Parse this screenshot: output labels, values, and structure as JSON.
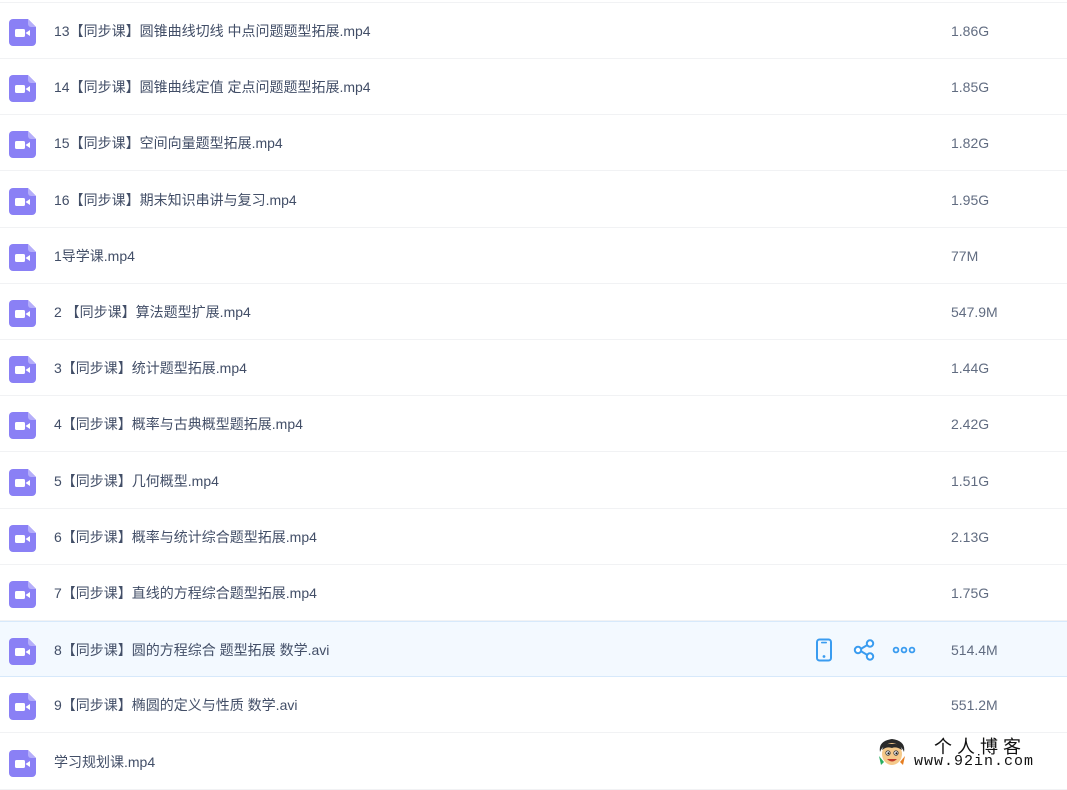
{
  "file_list": {
    "items": [
      {
        "name": "13【同步课】圆锥曲线切线 中点问题题型拓展.mp4",
        "size": "1.86G",
        "icon": "video-file-icon"
      },
      {
        "name": "14【同步课】圆锥曲线定值 定点问题题型拓展.mp4",
        "size": "1.85G",
        "icon": "video-file-icon"
      },
      {
        "name": "15【同步课】空间向量题型拓展.mp4",
        "size": "1.82G",
        "icon": "video-file-icon"
      },
      {
        "name": "16【同步课】期末知识串讲与复习.mp4",
        "size": "1.95G",
        "icon": "video-file-icon"
      },
      {
        "name": "1导学课.mp4",
        "size": "77M",
        "icon": "video-file-icon"
      },
      {
        "name": "2 【同步课】算法题型扩展.mp4",
        "size": "547.9M",
        "icon": "video-file-icon"
      },
      {
        "name": "3【同步课】统计题型拓展.mp4",
        "size": "1.44G",
        "icon": "video-file-icon"
      },
      {
        "name": "4【同步课】概率与古典概型题拓展.mp4",
        "size": "2.42G",
        "icon": "video-file-icon"
      },
      {
        "name": "5【同步课】几何概型.mp4",
        "size": "1.51G",
        "icon": "video-file-icon"
      },
      {
        "name": "6【同步课】概率与统计综合题型拓展.mp4",
        "size": "2.13G",
        "icon": "video-file-icon"
      },
      {
        "name": "7【同步课】直线的方程综合题型拓展.mp4",
        "size": "1.75G",
        "icon": "video-file-icon"
      },
      {
        "name": "8【同步课】圆的方程综合 题型拓展 数学.avi",
        "size": "514.4M",
        "icon": "video-file-icon",
        "hovered": true
      },
      {
        "name": "9【同步课】椭圆的定义与性质 数学.avi",
        "size": "551.2M",
        "icon": "video-file-icon"
      },
      {
        "name": "学习规划课.mp4",
        "size": "",
        "icon": "video-file-icon"
      }
    ],
    "hover_actions": [
      {
        "name": "phone-icon",
        "label": "send to phone"
      },
      {
        "name": "share-icon",
        "label": "share"
      },
      {
        "name": "more-icon",
        "label": "more"
      }
    ]
  },
  "watermark": {
    "title": "个人博客",
    "url": "www.92in.com"
  },
  "colors": {
    "icon_purple": "#8a80f5",
    "action_blue": "#3a9cf0",
    "hover_bg": "#f3f9ff",
    "divider": "#f1f2f4",
    "name_text": "#424e67",
    "size_text": "#616c81"
  }
}
